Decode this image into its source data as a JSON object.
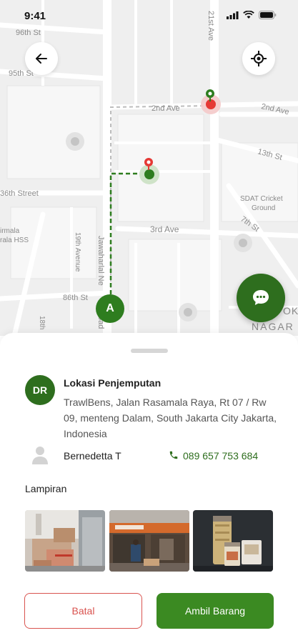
{
  "status": {
    "time": "9:41"
  },
  "map": {
    "labels": {
      "st96": "96th St",
      "st95": "95th St",
      "ave21": "21st Ave",
      "ave2nd_a": "2nd Ave",
      "ave2nd_b": "2nd Ave",
      "st13": "13th St",
      "st36": "36th Street",
      "sdat": "SDAT Cricket",
      "ground": "Ground",
      "st7": "7th St",
      "ave3rd": "3rd Ave",
      "mala1": "irmala",
      "mala2": "rala HSS",
      "ave19": "19th Avenue",
      "jawaharlal": "Jawaharlal Ne",
      "oad": "oad",
      "st86": "86th St",
      "st18": "18th",
      "ok": "OK",
      "nagar": "NAGAR"
    },
    "origin_marker": "A"
  },
  "sheet": {
    "avatar_initials": "DR",
    "pickup_title": "Lokasi Penjemputan",
    "pickup_address": "TrawlBens, Jalan Rasamala Raya, Rt 07 / Rw 09, menteng Dalam, South Jakarta City Jakarta, Indonesia",
    "contact_name": "Bernedetta T",
    "contact_phone": "089 657 753 684",
    "attachments_title": "Lampiran",
    "cancel_label": "Batal",
    "take_label": "Ambil Barang"
  },
  "colors": {
    "primary_green": "#2e6e1e",
    "button_green": "#3b8a22",
    "danger_red": "#d9534f"
  }
}
